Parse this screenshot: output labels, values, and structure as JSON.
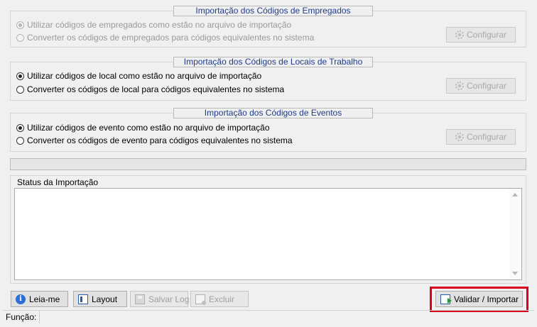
{
  "groups": {
    "employees": {
      "title": "Importação dos Códigos de Empregados",
      "option1": "Utilizar códigos de empregados como estão no arquivo de importação",
      "option2": "Converter os códigos de empregados para códigos equivalentes no sistema",
      "configure": "Configurar"
    },
    "locations": {
      "title": "Importação dos Códigos de Locais de Trabalho",
      "option1": "Utilizar códigos de local como estão no arquivo de importação",
      "option2": "Converter os códigos de local para códigos equivalentes no sistema",
      "configure": "Configurar"
    },
    "events": {
      "title": "Importação dos Códigos de Eventos",
      "option1": "Utilizar códigos de evento como estão no arquivo de importação",
      "option2": "Converter os códigos de evento para códigos equivalentes no sistema",
      "configure": "Configurar"
    }
  },
  "progress": {
    "value_percent": 0
  },
  "status": {
    "label": "Status da Importação",
    "text": ""
  },
  "toolbar": {
    "readme_label": "Leia-me",
    "layout_label": "Layout",
    "save_log_label": "Salvar Log",
    "delete_label": "Excluir",
    "validate_import_label": "Validar / Importar"
  },
  "statusbar": {
    "function_label": "Função:"
  },
  "icons": {
    "readme": "info-icon",
    "layout": "layout-icon",
    "save_log": "disk-icon",
    "delete": "delete-icon",
    "validate_import": "import-icon",
    "configure": "gear-icon"
  },
  "colors": {
    "group_title_text": "#1f3b8a",
    "highlight_border": "#d9001b",
    "window_background": "#f0f0f0"
  }
}
